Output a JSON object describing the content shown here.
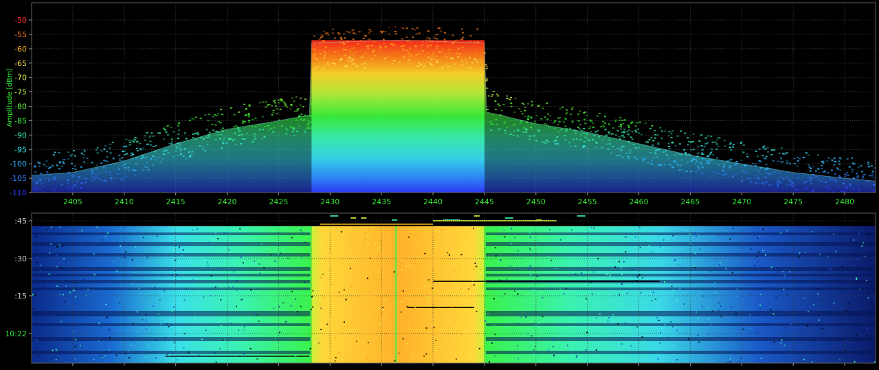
{
  "colors": {
    "background": "#000000",
    "grid": "#3a3a3a",
    "frame": "#606060",
    "tick_mark": "#9a9a9a",
    "x_tick_label": "#36e636",
    "time_label_primary": "#36e636",
    "time_label_secondary": "#cfcfcf",
    "ylabel": "#36e636",
    "y_tick_by_level": {
      "-50": "#ff2a2a",
      "-55": "#ff7a1a",
      "-60": "#ffb020",
      "-65": "#ffe04a",
      "-70": "#e6f24a",
      "-75": "#b8f24a",
      "-80": "#68f23a",
      "-85": "#38f23a",
      "-90": "#3af2a8",
      "-95": "#3ae8f2",
      "-100": "#2fb8ff",
      "-105": "#2f7cff",
      "-110": "#2f44ff"
    }
  },
  "chart_data": [
    {
      "type": "area",
      "name": "spectrum",
      "ylabel": "Amplitude [dBm]",
      "xlabel": "",
      "x_ticks": [
        2405,
        2410,
        2415,
        2420,
        2425,
        2430,
        2435,
        2440,
        2445,
        2450,
        2455,
        2460,
        2465,
        2470,
        2475,
        2480
      ],
      "y_ticks": [
        -50,
        -55,
        -60,
        -65,
        -70,
        -75,
        -80,
        -85,
        -90,
        -95,
        -100,
        -105,
        -110
      ],
      "xlim": [
        2401,
        2483
      ],
      "ylim": [
        -110,
        -44
      ],
      "grid": true,
      "channel_band": {
        "start": 2428.2,
        "end": 2445.0,
        "peak_dbm": -57,
        "top_dbm": -52,
        "floor_dbm": -72
      },
      "series": [
        {
          "x": [
            2401,
            2405,
            2410,
            2415,
            2420,
            2425,
            2428,
            2428.2,
            2436.5,
            2445,
            2445.2,
            2450,
            2455,
            2460,
            2465,
            2470,
            2475,
            2480,
            2483
          ],
          "y": [
            -104,
            -103,
            -99,
            -93,
            -88,
            -85,
            -83,
            -58,
            -57,
            -58,
            -82,
            -86,
            -89,
            -93,
            -97,
            -100,
            -103,
            -105,
            -106
          ]
        }
      ]
    },
    {
      "type": "heatmap",
      "name": "waterfall",
      "xlim": [
        2401,
        2483
      ],
      "time_ticks": [
        {
          "label": ":45",
          "primary": false
        },
        {
          "label": ":30",
          "primary": false
        },
        {
          "label": ":15",
          "primary": false
        },
        {
          "label": "10:22",
          "primary": true
        }
      ],
      "grid": true,
      "channel_band": {
        "start": 2428.2,
        "end": 2445.0
      },
      "levels": {
        "outer": "#0a2a8a",
        "mid": "#1a7ad8",
        "skirt": "#4ae8e8",
        "shoulder": "#3af26a",
        "band_edge": "#d8f23a",
        "band_core": "#ffb020"
      }
    }
  ]
}
